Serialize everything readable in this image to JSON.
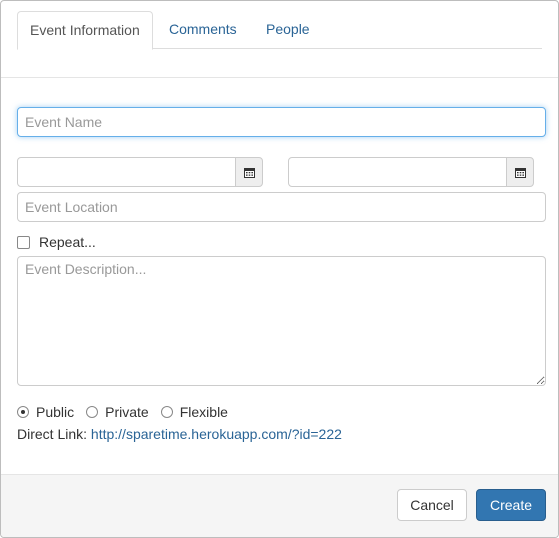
{
  "tabs": [
    {
      "label": "Event Information",
      "active": true
    },
    {
      "label": "Comments",
      "active": false
    },
    {
      "label": "People",
      "active": false
    }
  ],
  "form": {
    "event_name_placeholder": "Event Name",
    "start_date_value": "",
    "end_date_value": "",
    "calendar_icon": "calendar-icon",
    "location_placeholder": "Event Location",
    "repeat_label": "Repeat...",
    "repeat_checked": false,
    "description_placeholder": "Event Description...",
    "visibility_options": [
      {
        "label": "Public",
        "checked": true
      },
      {
        "label": "Private",
        "checked": false
      },
      {
        "label": "Flexible",
        "checked": false
      }
    ],
    "direct_link_label": "Direct Link:",
    "direct_link_url": "http://sparetime.herokuapp.com/?id=222"
  },
  "footer": {
    "cancel_label": "Cancel",
    "create_label": "Create"
  },
  "colors": {
    "link": "#2a6496",
    "primary": "#3276b1",
    "focus": "#66afe9"
  }
}
